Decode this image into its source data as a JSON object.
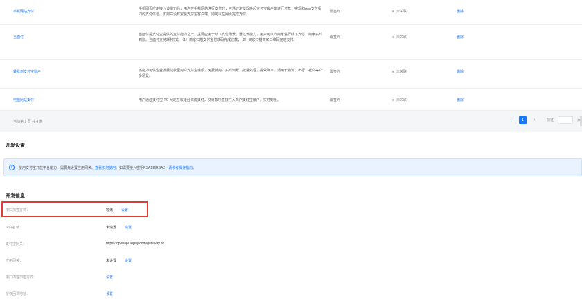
{
  "table": {
    "rows": [
      {
        "name": "手机网站支付",
        "desc": "手机网页应用接入该能力后，用户在手机网站进行支付时，可通过浏览器唤起支付宝客户端进行付款，实现和App支付相同的支付体验。如用户没有安装支付宝客户端，则可以在网页完成支付。",
        "status": "需签约",
        "bind": "未关联",
        "action": "删除"
      },
      {
        "name": "当面付",
        "desc": "当面付是支付宝提供的支付能力之一。主要应用于线下支付场景。通过该能力，用户可以向商家进行线下支付，商家实时到账。当面付支持2种形式：（1）商家扫描支付宝付款码完成收款；（2）买家扫描商家二维码完成支付。",
        "status": "需签约",
        "bind": "未关联",
        "action": "删除"
      },
      {
        "name": "转账到支付宝账户",
        "desc": "该能力可供企业批量付款至用户支付宝余额，免费使用，实时到账，批量处理，提效降本，适用于物流、出行、社交等众多场景。",
        "status": "需签约",
        "bind": "未关联",
        "action": "删除"
      },
      {
        "name": "电脑网站支付",
        "desc": "用户通过支付宝 PC 网站在收银台完成支付，交易款项直接打入商户支付宝账户，实时到账。",
        "status": "需签约",
        "bind": "未关联",
        "action": "删除"
      }
    ],
    "footer": {
      "count": "当前第 1 页 共 4 条",
      "current_page": "1",
      "goto_label": "前往",
      "goto_suffix": "页"
    }
  },
  "dev_settings": {
    "title": "开发设置",
    "notice_text": "使用支付宝开放平台能力，需要先设置应用网关。",
    "notice_link1": "查看如何使用",
    "notice_middle": "。如需要接入密钥RSA1到RSA2，",
    "notice_link2": "请参考操作指南",
    "notice_end": "。"
  },
  "dev_info": {
    "title": "开发信息",
    "items": [
      {
        "label": "接口加签方式：",
        "value": "暂无",
        "link": "设置"
      },
      {
        "label": "IP白名单：",
        "value": "未设置",
        "link": "设置"
      },
      {
        "label": "支付宝网关：",
        "value": "https://openapi.alipay.com/gateway.do",
        "link": ""
      },
      {
        "label": "应用网关：",
        "value": "未设置",
        "link": "设置"
      },
      {
        "label": "接口内容加密方式：",
        "value": "",
        "link": "设置"
      },
      {
        "label": "授权回调地址：",
        "value": "",
        "link": "设置"
      }
    ]
  },
  "icons": {
    "notice": "info-icon",
    "prev": "chevron-left-icon",
    "next": "chevron-right-icon"
  },
  "colors": {
    "accent": "#1677ff",
    "highlight": "#e53935",
    "notice_bg": "#e8f3ff"
  }
}
